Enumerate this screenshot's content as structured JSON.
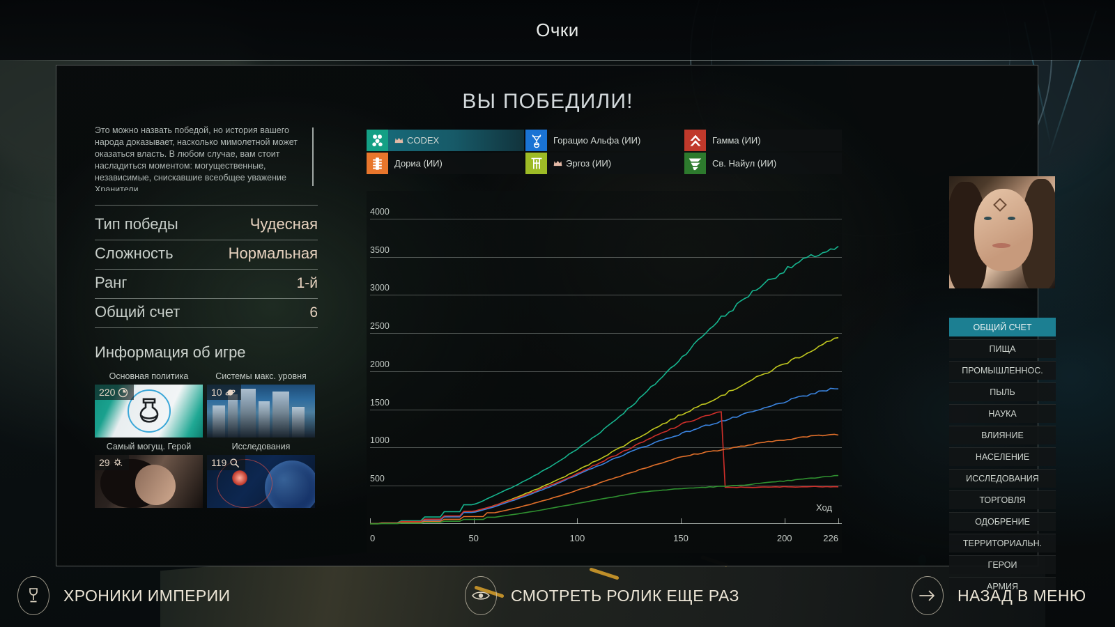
{
  "header": {
    "title": "Очки"
  },
  "panel": {
    "victory_title": "ВЫ ПОБЕДИЛИ!"
  },
  "left": {
    "description": "Это можно назвать победой, но история вашего народа доказывает, насколько мимолетной может оказаться власть. В любом случае, вам стоит насладиться моментом: могущественные, независимые, снискавшие всеобщее уважение Хранители",
    "stats": [
      {
        "key": "Тип победы",
        "value": "Чудесная"
      },
      {
        "key": "Сложность",
        "value": "Нормальная"
      },
      {
        "key": "Ранг",
        "value": "1-й"
      },
      {
        "key": "Общий счет",
        "value": "6"
      }
    ],
    "game_info_title": "Информация об игре",
    "cards": [
      {
        "label": "Основная политика",
        "badge": "220",
        "icon": "clock-icon"
      },
      {
        "label": "Системы макс. уровня",
        "badge": "10",
        "icon": "planet-icon"
      },
      {
        "label": "Самый могущ. Герой",
        "badge": "29",
        "icon": "hero-star-icon"
      },
      {
        "label": "Исследования",
        "badge": "119",
        "icon": "magnifier-icon"
      }
    ]
  },
  "factions": [
    {
      "name": "CODEX",
      "color": "#14a085",
      "crown": true,
      "active": true,
      "icon": "flower-cluster-icon"
    },
    {
      "name": "Горацио Альфа (ИИ)",
      "color": "#1a73d4",
      "crown": false,
      "active": false,
      "icon": "horatio-icon"
    },
    {
      "name": "Гамма (ИИ)",
      "color": "#c0392b",
      "crown": false,
      "active": false,
      "icon": "chevron-up-icon"
    },
    {
      "name": "Дориа (ИИ)",
      "color": "#e8762c",
      "crown": false,
      "active": false,
      "icon": "ladder-icon"
    },
    {
      "name": "Эргоз (ИИ)",
      "color": "#9dbb26",
      "crown": true,
      "active": false,
      "icon": "pillar-icon"
    },
    {
      "name": "Св. Найул (ИИ)",
      "color": "#2d7a2d",
      "crown": false,
      "active": false,
      "icon": "serpent-icon"
    }
  ],
  "chart_data": {
    "type": "line",
    "title": "",
    "xlabel": "Ход",
    "ylabel": "",
    "xlim": [
      0,
      226
    ],
    "ylim": [
      0,
      4200
    ],
    "grid": true,
    "legend_position": "above-chart",
    "yticks": [
      500,
      1000,
      1500,
      2000,
      2500,
      3000,
      3500,
      4000
    ],
    "xticks": [
      0,
      50,
      100,
      150,
      200,
      226
    ],
    "x": [
      0,
      10,
      20,
      30,
      40,
      50,
      60,
      70,
      80,
      90,
      100,
      110,
      120,
      130,
      140,
      150,
      160,
      170,
      172,
      180,
      190,
      200,
      210,
      220,
      226
    ],
    "series": [
      {
        "name": "CODEX",
        "color": "#16b58f",
        "values": [
          5,
          15,
          40,
          90,
          160,
          250,
          370,
          500,
          640,
          800,
          980,
          1180,
          1400,
          1640,
          1900,
          2170,
          2450,
          2720,
          2740,
          2940,
          3150,
          3320,
          3470,
          3570,
          3610
        ]
      },
      {
        "name": "Эргоз (ИИ)",
        "color": "#c2c91f",
        "values": [
          3,
          10,
          25,
          55,
          100,
          160,
          240,
          340,
          450,
          570,
          700,
          840,
          990,
          1140,
          1290,
          1430,
          1560,
          1690,
          1710,
          1830,
          1960,
          2100,
          2230,
          2370,
          2440
        ]
      },
      {
        "name": "Горацио Альфа (ИИ)",
        "color": "#3a84e0",
        "values": [
          3,
          9,
          22,
          50,
          92,
          150,
          225,
          315,
          415,
          525,
          640,
          760,
          880,
          990,
          1090,
          1180,
          1270,
          1350,
          1360,
          1430,
          1510,
          1600,
          1680,
          1750,
          1780
        ]
      },
      {
        "name": "Гамма (ИИ)",
        "color": "#cf2f2a",
        "values": [
          4,
          12,
          30,
          62,
          105,
          165,
          240,
          330,
          430,
          540,
          660,
          790,
          920,
          1050,
          1180,
          1300,
          1400,
          1470,
          480,
          480,
          480,
          485,
          487,
          489,
          490
        ]
      },
      {
        "name": "Дориа (ИИ)",
        "color": "#e2702a",
        "values": [
          2,
          7,
          16,
          34,
          60,
          96,
          145,
          205,
          275,
          355,
          440,
          530,
          620,
          710,
          795,
          875,
          930,
          975,
          980,
          1020,
          1065,
          1105,
          1140,
          1165,
          1175
        ]
      },
      {
        "name": "Св. Найул (ИИ)",
        "color": "#2f9130",
        "values": [
          1,
          4,
          10,
          20,
          35,
          58,
          88,
          125,
          170,
          218,
          268,
          318,
          368,
          412,
          440,
          462,
          478,
          492,
          494,
          510,
          535,
          562,
          590,
          618,
          632
        ]
      }
    ]
  },
  "sidebar": {
    "items": [
      {
        "label": "ОБЩИЙ СЧЕТ",
        "active": true
      },
      {
        "label": "ПИЩА",
        "active": false
      },
      {
        "label": "ПРОМЫШЛЕННОС.",
        "active": false
      },
      {
        "label": "ПЫЛЬ",
        "active": false
      },
      {
        "label": "НАУКА",
        "active": false
      },
      {
        "label": "ВЛИЯНИЕ",
        "active": false
      },
      {
        "label": "НАСЕЛЕНИЕ",
        "active": false
      },
      {
        "label": "ИССЛЕДОВАНИЯ",
        "active": false
      },
      {
        "label": "ТОРГОВЛЯ",
        "active": false
      },
      {
        "label": "ОДОБРЕНИЕ",
        "active": false
      },
      {
        "label": "ТЕРРИТОРИАЛЬН.",
        "active": false
      },
      {
        "label": "ГЕРОИ",
        "active": false
      },
      {
        "label": "АРМИЯ",
        "active": false
      }
    ]
  },
  "bottom_bar": {
    "buttons": [
      {
        "label": "ХРОНИКИ ИМПЕРИИ",
        "icon": "trophy-icon"
      },
      {
        "label": "СМОТРЕТЬ РОЛИК ЕЩЕ РАЗ",
        "icon": "eye-icon"
      },
      {
        "label": "НАЗАД В МЕНЮ",
        "icon": "arrow-right-icon"
      }
    ]
  },
  "colors": {
    "accent": "#1c7f92",
    "value_text": "#e8d3c0"
  }
}
